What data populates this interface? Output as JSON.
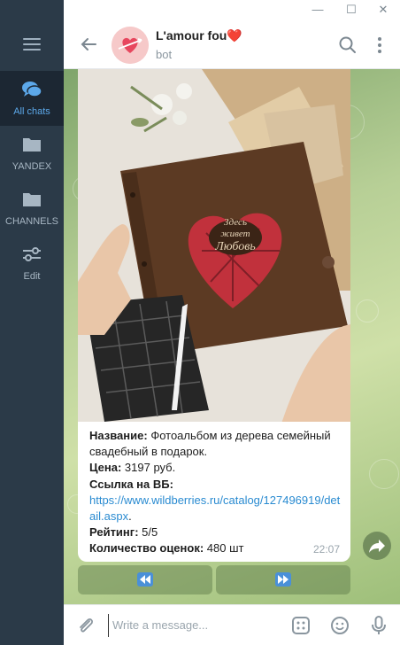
{
  "window": {
    "minimize_glyph": "—",
    "maximize_glyph": "☐",
    "close_glyph": "✕"
  },
  "sidebar": {
    "items": [
      {
        "label": "All chats",
        "icon": "chat-bubbles-icon"
      },
      {
        "label": "YANDEX",
        "icon": "folder-icon"
      },
      {
        "label": "CHANNELS",
        "icon": "folder-icon"
      },
      {
        "label": "Edit",
        "icon": "sliders-icon"
      }
    ]
  },
  "header": {
    "title": "L'amour fou❤️",
    "subtitle": "bot"
  },
  "message": {
    "fields": [
      {
        "key": "Название:",
        "value": " Фотоальбом из дерева семейный свадебный в подарок."
      },
      {
        "key": "Цена:",
        "value": " 3197 руб."
      },
      {
        "key": "Ссылка на ВБ:",
        "value": ""
      },
      {
        "key": "Рейтинг:",
        "value": " 5/5"
      },
      {
        "key": "Количество оценок:",
        "value": " 480 шт"
      }
    ],
    "link": "https://www.wildberries.ru/catalog/127496919/detail.aspx",
    "link_suffix": ".",
    "time": "22:07",
    "photo_text_line1": "Здесь",
    "photo_text_line2": "живет",
    "photo_text_line3": "Любовь"
  },
  "keyboard": {
    "buttons": [
      {
        "icon": "rewind-icon",
        "glyph": "⏪"
      },
      {
        "icon": "fast-forward-icon",
        "glyph": "⏩"
      }
    ]
  },
  "composer": {
    "placeholder": "Write a message..."
  },
  "colors": {
    "sidebar_bg": "#2b3a48",
    "accent": "#5ca8ea",
    "link": "#2a8bd1"
  }
}
